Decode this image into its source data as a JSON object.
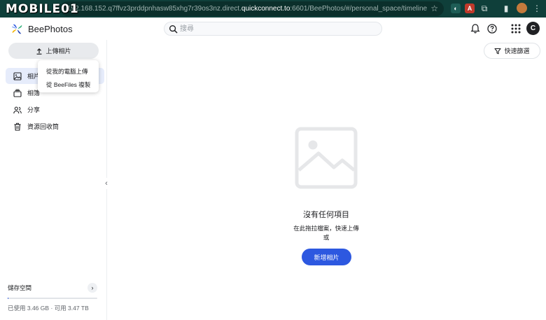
{
  "browser": {
    "watermark": "MOBILE01",
    "url_prefix": "192.168.152.q7ffvz3prddpnhasw85xhg7r39os3nz.direct.",
    "url_host": "quickconnect.to",
    "url_path": ":6601/BeePhotos/#/personal_space/timeline"
  },
  "app": {
    "name": "BeePhotos",
    "avatar_initial": "C",
    "accent_color": "#2d58e0"
  },
  "search": {
    "placeholder": "搜尋"
  },
  "sidebar": {
    "upload_label": "上傳相片",
    "items": [
      {
        "label": "相片",
        "icon": "photo-icon",
        "active": true
      },
      {
        "label": "相簿",
        "icon": "album-icon",
        "active": false
      },
      {
        "label": "分享",
        "icon": "people-icon",
        "active": false
      },
      {
        "label": "資源回收筒",
        "icon": "trash-icon",
        "active": false
      }
    ],
    "storage": {
      "title": "儲存空間",
      "used_label": "已使用 3.46 GB",
      "separator": "·",
      "free_label": "可用 3.47 TB",
      "used_fraction": 0.001
    }
  },
  "upload_menu": {
    "items": [
      "從我的電腦上傳",
      "從 BeeFiles 複製"
    ]
  },
  "toolbar": {
    "filter_label": "快速篩選"
  },
  "empty_state": {
    "title": "沒有任何項目",
    "subtitle": "在此拖拉檔案，快速上傳",
    "or": "或",
    "button": "新增相片"
  }
}
